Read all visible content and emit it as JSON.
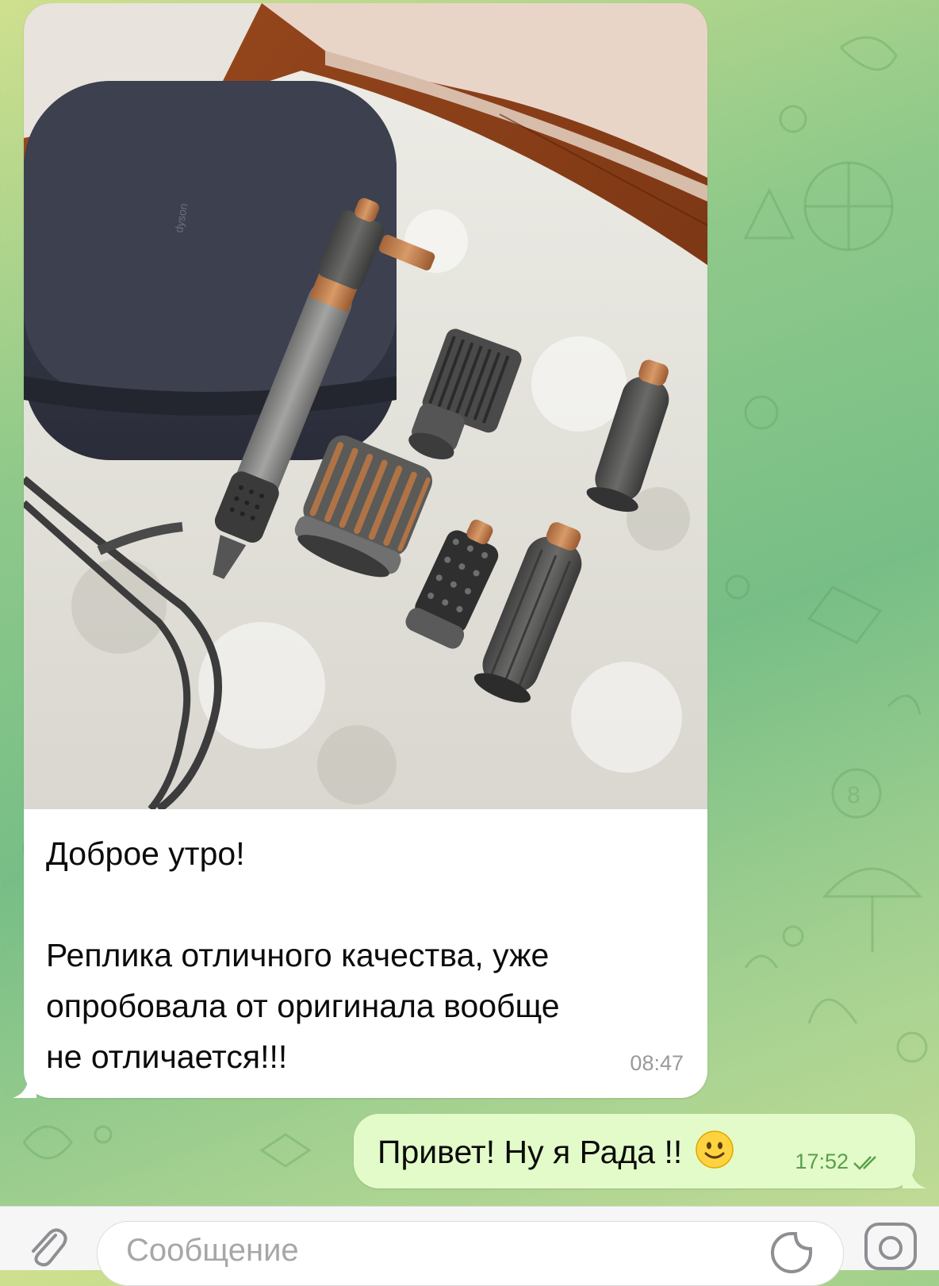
{
  "chat": {
    "incoming": {
      "photo_icon": "dyson-airwrap-set-photo",
      "greeting": "Доброе утро!",
      "text": "Реплика отличного качества, уже\nопробовала от оригинала вообще\nне отличается!!!",
      "time": "08:47"
    },
    "outgoing": {
      "text": "Привет! Ну я Рада !!",
      "emoji": "slightly-smiling-face-icon",
      "time": "17:52",
      "status_icon": "double-check-icon"
    }
  },
  "composer": {
    "placeholder": "Сообщение",
    "attach_icon": "paperclip-icon",
    "sticker_icon": "sticker-icon",
    "camera_icon": "camera-icon"
  },
  "colors": {
    "bubble_in": "#ffffff",
    "bubble_out": "#e3fbc8",
    "read_check": "#58a04d",
    "wallpaper": "#8fc98a"
  }
}
